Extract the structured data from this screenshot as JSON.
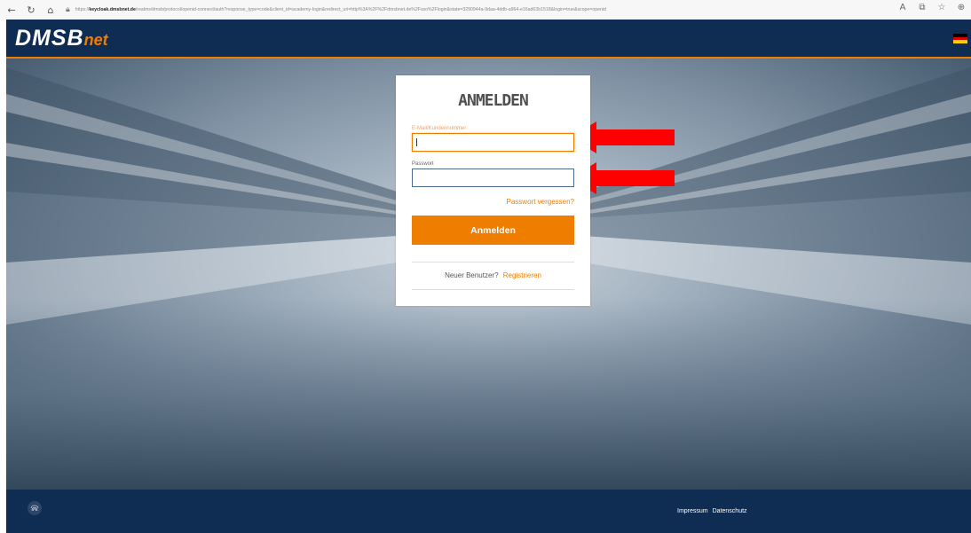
{
  "browser": {
    "url_prefix": "https://",
    "url_host": "keycloak.dmsbnet.de",
    "url_path": "/realms/dmsb/protocol/openid-connect/auth?response_type=code&client_id=academy-login&redirect_uri=http%3A%2F%2Fdmsbnet.de%2Fsso%2Flogin&state=3290944a-9daa-4ddb-a964-e16ad63b1518&login=true&scope=openid",
    "icons": [
      "back-icon",
      "refresh-icon",
      "home-icon",
      "lock-icon",
      "read-aloud-icon",
      "collections-icon",
      "favorites-icon",
      "extensions-icon"
    ]
  },
  "header": {
    "logo_main": "DMSB",
    "logo_sub": "net",
    "flag": [
      "#000000",
      "#dd0000",
      "#ffce00"
    ]
  },
  "login": {
    "title": "ANMELDEN",
    "email_label": "E-Mail/Kundennummer",
    "email_value": "",
    "password_label": "Passwort",
    "password_value": "",
    "forgot_link": "Passwort vergessen?",
    "submit_label": "Anmelden",
    "new_user_text": "Neuer Benutzer?",
    "register_link": "Registrieren"
  },
  "footer": {
    "impressum": "Impressum",
    "datenschutz": "Datenschutz"
  },
  "colors": {
    "brand_navy": "#0f2c52",
    "accent_orange": "#ef7d00",
    "annotation_red": "#ff0000"
  }
}
